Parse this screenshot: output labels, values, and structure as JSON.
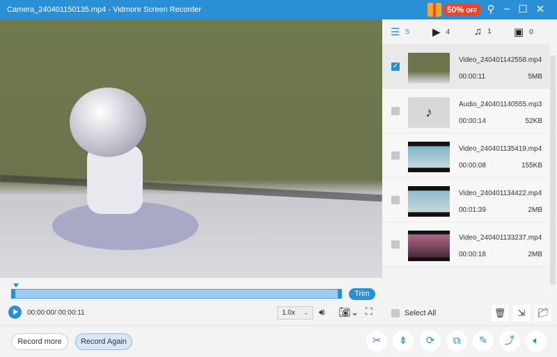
{
  "window": {
    "title": "Camera_240401150135.mp4  -  Vidmore Screen Recorder",
    "promo": "50%",
    "promo_suffix": "OFF"
  },
  "player": {
    "trim_label": "Trim",
    "time": "00:00:00/ 00:00:11",
    "speed": "1.0x",
    "progress": 0
  },
  "filters": [
    {
      "icon": "list-icon",
      "count": "5"
    },
    {
      "icon": "video-icon",
      "count": "4"
    },
    {
      "icon": "music-icon",
      "count": "1"
    },
    {
      "icon": "image-icon",
      "count": "0"
    }
  ],
  "files": [
    {
      "name": "Video_240401142558.mp4",
      "duration": "00:00:11",
      "size": "5MB",
      "checked": true
    },
    {
      "name": "Audio_240401140555.mp3",
      "duration": "00:00:14",
      "size": "52KB",
      "checked": false
    },
    {
      "name": "Video_240401135419.mp4",
      "duration": "00:00:08",
      "size": "155KB",
      "checked": false
    },
    {
      "name": "Video_240401134422.mp4",
      "duration": "00:01:39",
      "size": "2MB",
      "checked": false
    },
    {
      "name": "Video_240401133237.mp4",
      "duration": "00:00:18",
      "size": "2MB",
      "checked": false
    }
  ],
  "select_all": "Select All",
  "bottom": {
    "record_more": "Record more",
    "record_again": "Record Again"
  },
  "colors": {
    "accent": "#2b8fd6",
    "promo": "#e8452c"
  }
}
